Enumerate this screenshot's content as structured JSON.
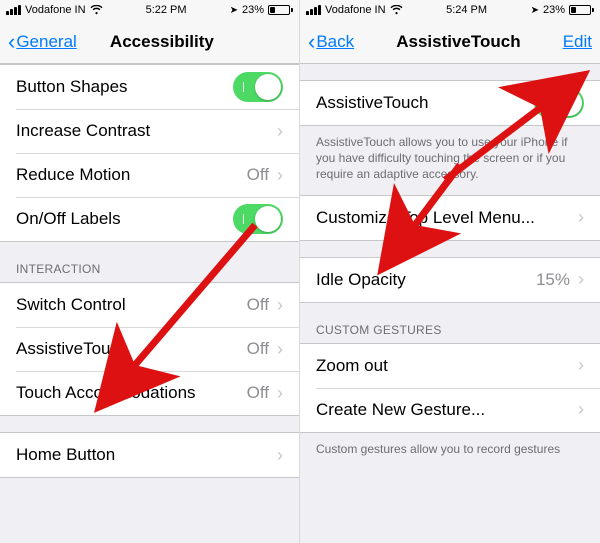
{
  "left": {
    "status": {
      "carrier": "Vodafone IN",
      "time": "5:22 PM",
      "battery": "23%"
    },
    "nav": {
      "back": "General",
      "title": "Accessibility"
    },
    "row1": {
      "label": "Button Shapes"
    },
    "row2": {
      "label": "Increase Contrast"
    },
    "row3": {
      "label": "Reduce Motion",
      "value": "Off"
    },
    "row4": {
      "label": "On/Off Labels"
    },
    "sectionInteraction": "INTERACTION",
    "row5": {
      "label": "Switch Control",
      "value": "Off"
    },
    "row6": {
      "label": "AssistiveTouch",
      "value": "Off"
    },
    "row7": {
      "label": "Touch Accommodations",
      "value": "Off"
    },
    "row8": {
      "label": "Home Button"
    }
  },
  "right": {
    "status": {
      "carrier": "Vodafone IN",
      "time": "5:24 PM",
      "battery": "23%"
    },
    "nav": {
      "back": "Back",
      "title": "AssistiveTouch",
      "edit": "Edit"
    },
    "row1": {
      "label": "AssistiveTouch"
    },
    "footer1": "AssistiveTouch allows you to use your iPhone if you have difficulty touching the screen or if you require an adaptive accessory.",
    "row2": {
      "label": "Customize Top Level Menu..."
    },
    "row3": {
      "label": "Idle Opacity",
      "value": "15%"
    },
    "sectionCustom": "CUSTOM GESTURES",
    "row4": {
      "label": "Zoom out"
    },
    "row5": {
      "label": "Create New Gesture..."
    },
    "footer2": "Custom gestures allow you to record gestures"
  }
}
